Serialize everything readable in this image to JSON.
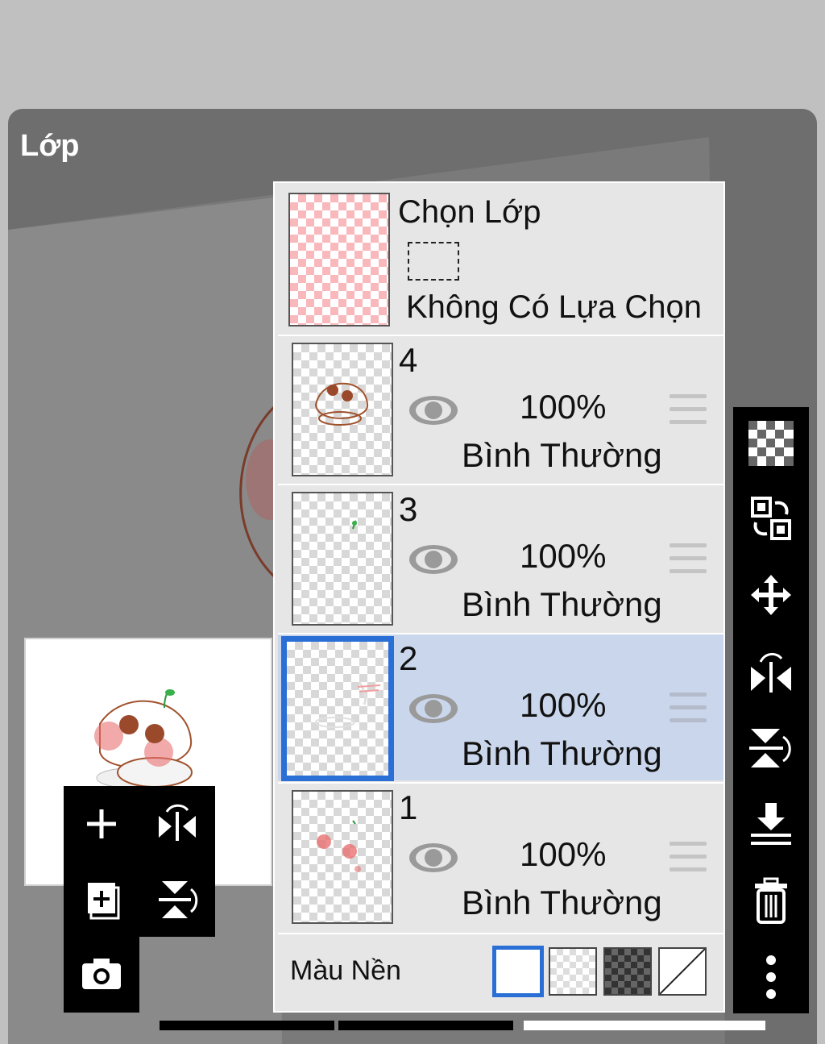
{
  "panel": {
    "title": "Lớp"
  },
  "selection_layer": {
    "title": "Chọn Lớp",
    "subtitle": "Không Có Lựa Chọn"
  },
  "layers": [
    {
      "number": "4",
      "opacity": "100%",
      "blend": "Bình Thường"
    },
    {
      "number": "3",
      "opacity": "100%",
      "blend": "Bình Thường"
    },
    {
      "number": "2",
      "opacity": "100%",
      "blend": "Bình Thường"
    },
    {
      "number": "1",
      "opacity": "100%",
      "blend": "Bình Thường"
    }
  ],
  "selected_layer": "2",
  "background": {
    "label": "Màu Nền",
    "options": [
      "white",
      "transparent",
      "dark-checker",
      "none"
    ],
    "selected": "white"
  },
  "left_tools": [
    "add-layer-icon",
    "flip-horizontal-icon",
    "add-copy-icon",
    "flip-vertical-icon",
    "camera-icon"
  ],
  "right_tools": [
    "transparency-icon",
    "swap-icon",
    "move-icon",
    "flip-horizontal-icon",
    "flip-vertical-icon",
    "merge-down-icon",
    "trash-icon",
    "more-icon"
  ],
  "colors": {
    "accent": "#2a6fd6",
    "selected_row": "#c9d6eb",
    "panel": "#6e6e6e"
  }
}
